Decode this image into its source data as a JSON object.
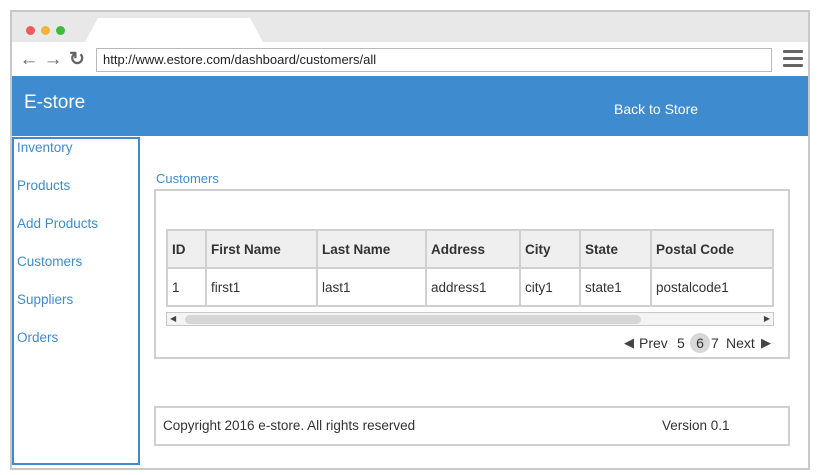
{
  "browser": {
    "url": "http://www.estore.com/dashboard/customers/all"
  },
  "header": {
    "brand": "E-store",
    "back_link": "Back to Store"
  },
  "sidebar": {
    "items": [
      {
        "label": "Inventory"
      },
      {
        "label": "Products"
      },
      {
        "label": "Add Products"
      },
      {
        "label": "Customers"
      },
      {
        "label": "Suppliers"
      },
      {
        "label": "Orders"
      }
    ]
  },
  "main": {
    "breadcrumb": "Customers",
    "table": {
      "columns": [
        "ID",
        "First Name",
        "Last Name",
        "Address",
        "City",
        "State",
        "Postal Code"
      ],
      "rows": [
        [
          "1",
          "first1",
          "last1",
          "address1",
          "city1",
          "state1",
          "postalcode1"
        ]
      ]
    },
    "pager": {
      "prev": "Prev",
      "pages": [
        "5",
        "6",
        "7"
      ],
      "current": "6",
      "next": "Next"
    }
  },
  "footer": {
    "copyright": "Copyright  2016 e-store. All rights reserved",
    "version": "Version 0.1"
  },
  "colors": {
    "accent": "#3e8bcf"
  }
}
